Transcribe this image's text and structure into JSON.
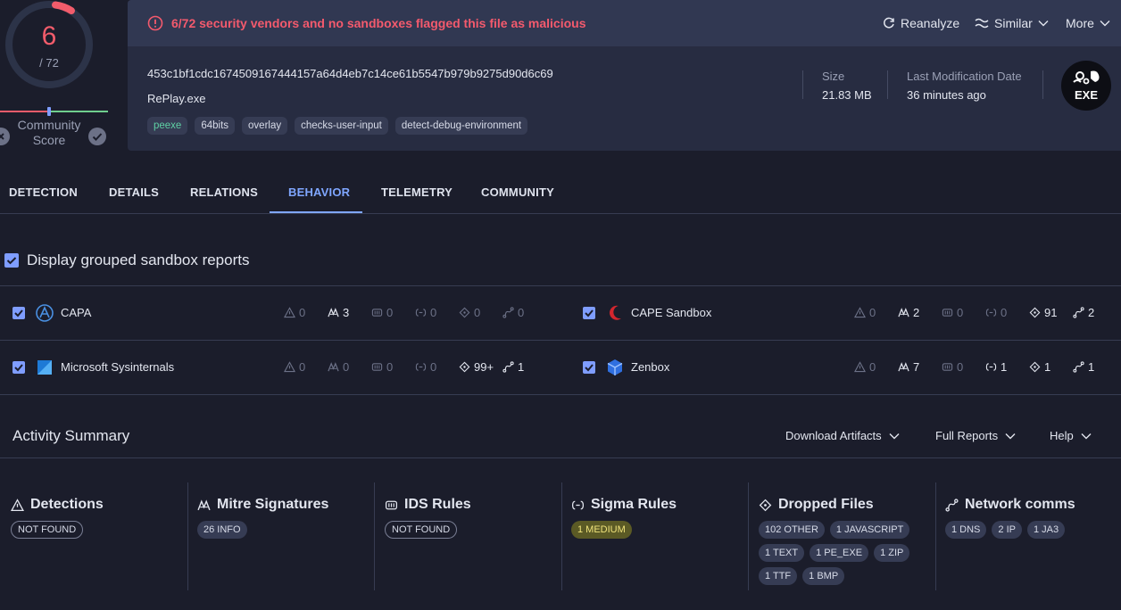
{
  "score": {
    "value": "6",
    "total": "/ 72",
    "community_label_1": "Community",
    "community_label_2": "Score"
  },
  "banner": {
    "text": "6/72 security vendors and no sandboxes flagged this file as malicious",
    "reanalyze": "Reanalyze",
    "similar": "Similar",
    "more": "More"
  },
  "file": {
    "hash": "453c1bf1cdc1674509167444157a64d4eb7c14ce61b5547b979b9275d90d6c69",
    "name": "RePlay.exe",
    "tags": [
      "peexe",
      "64bits",
      "overlay",
      "checks-user-input",
      "detect-debug-environment"
    ],
    "size_label": "Size",
    "size_value": "21.83 MB",
    "date_label": "Last Modification Date",
    "date_value": "36 minutes ago",
    "type_badge": "EXE"
  },
  "tabs": [
    "DETECTION",
    "DETAILS",
    "RELATIONS",
    "BEHAVIOR",
    "TELEMETRY",
    "COMMUNITY"
  ],
  "active_tab": "BEHAVIOR",
  "grouped_label": "Display grouped sandbox reports",
  "sandboxes": [
    {
      "name": "CAPA",
      "stats": [
        "0",
        "3",
        "0",
        "0",
        "0",
        "0"
      ]
    },
    {
      "name": "CAPE Sandbox",
      "stats": [
        "0",
        "2",
        "0",
        "0",
        "91",
        "2"
      ]
    },
    {
      "name": "Microsoft Sysinternals",
      "stats": [
        "0",
        "0",
        "0",
        "0",
        "99+",
        "1"
      ]
    },
    {
      "name": "Zenbox",
      "stats": [
        "0",
        "7",
        "0",
        "1",
        "1",
        "1"
      ]
    }
  ],
  "activity": {
    "title": "Activity Summary",
    "download": "Download Artifacts",
    "full_reports": "Full Reports",
    "help": "Help",
    "columns": [
      {
        "title": "Detections",
        "pills": [
          "NOT FOUND"
        ]
      },
      {
        "title": "Mitre Signatures",
        "pills": [
          "26 INFO"
        ]
      },
      {
        "title": "IDS Rules",
        "pills": [
          "NOT FOUND"
        ]
      },
      {
        "title": "Sigma Rules",
        "pills": [
          "1 MEDIUM"
        ]
      },
      {
        "title": "Dropped Files",
        "pills": [
          "102 OTHER",
          "1 JAVASCRIPT",
          "1 TEXT",
          "1 PE_EXE",
          "1 ZIP",
          "1 TTF",
          "1 BMP"
        ]
      },
      {
        "title": "Network comms",
        "pills": [
          "1 DNS",
          "2 IP",
          "1 JA3"
        ]
      }
    ]
  },
  "colors": {
    "accent": "#7fa6ff",
    "danger": "#f45a6d",
    "bg": "#1b1d2b",
    "card": "#272c41"
  }
}
